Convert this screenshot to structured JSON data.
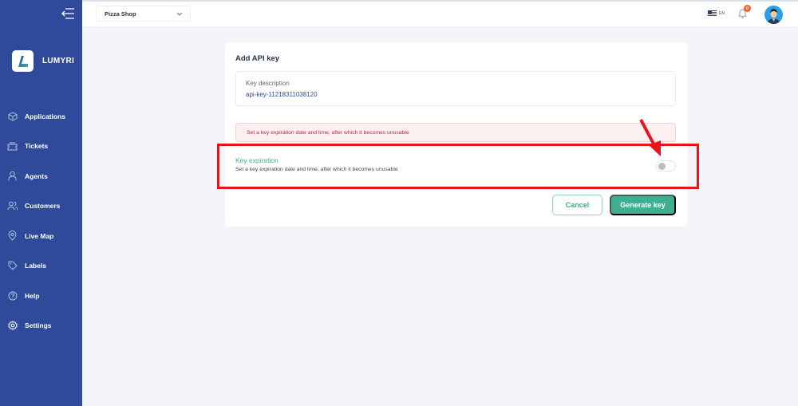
{
  "sidebar": {
    "brand": "LUMYRI",
    "items": [
      {
        "label": "Applications",
        "icon": "cube-icon",
        "active": false
      },
      {
        "label": "Tickets",
        "icon": "ticket-icon",
        "active": false
      },
      {
        "label": "Agents",
        "icon": "agent-icon",
        "active": false
      },
      {
        "label": "Customers",
        "icon": "users-icon",
        "active": false
      },
      {
        "label": "Live Map",
        "icon": "map-pin-icon",
        "active": false
      },
      {
        "label": "Labels",
        "icon": "tag-icon",
        "active": false
      },
      {
        "label": "Help",
        "icon": "help-icon",
        "active": false
      },
      {
        "label": "Settings",
        "icon": "gear-icon",
        "active": true
      }
    ]
  },
  "topbar": {
    "shop": "Pizza Shop",
    "language": "EN",
    "notifications": "0"
  },
  "form": {
    "title": "Add API key",
    "description_label": "Key description",
    "description_value": "api-key-11218311038120",
    "alert": "Set a key expiration date and time, after which it becomes unusable",
    "expiration_title": "Key expiration",
    "expiration_sub": "Set a key expiration date and time, after which it becomes unusable",
    "expiration_enabled": false,
    "cancel": "Cancel",
    "generate": "Generate key"
  },
  "colors": {
    "sidebar": "#2f4a9a",
    "accent": "#3fae91",
    "alert": "#c0283a",
    "annotation": "#e8141c"
  }
}
